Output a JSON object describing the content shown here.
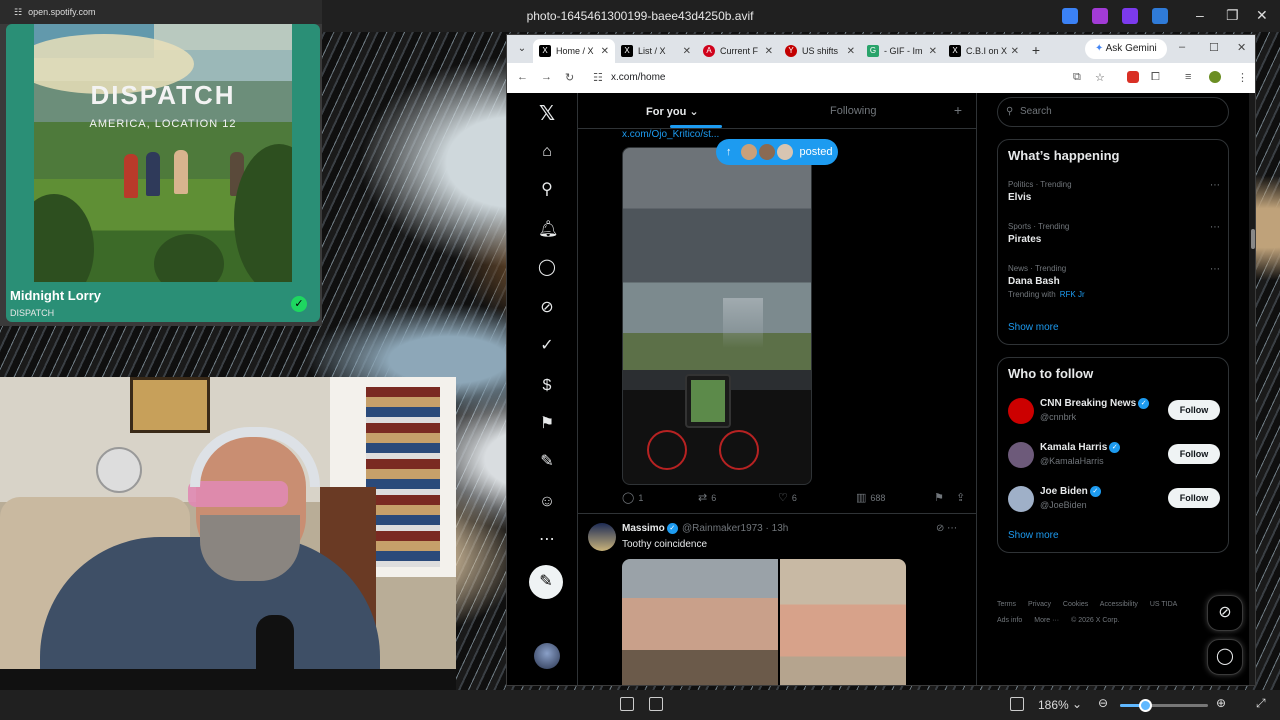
{
  "viewer": {
    "file_name": "photo-1645461300199-baee43d4250b.avif",
    "zoom": "186%",
    "zoom_fraction": 0.28
  },
  "spotify": {
    "url": "open.spotify.com",
    "album_title": "DISPATCH",
    "album_subtitle": "AMERICA, LOCATION 12",
    "track": "Midnight Lorry",
    "artist": "DISPATCH",
    "accent": "#1ed760"
  },
  "browser": {
    "tabs": [
      {
        "label": "Home / X",
        "icon": "x-logo-icon",
        "color": "#000000",
        "glyph": "X",
        "active": true
      },
      {
        "label": "List / X",
        "icon": "x-logo-icon",
        "color": "#000000",
        "glyph": "X",
        "active": false
      },
      {
        "label": "Current F",
        "icon": "red-a-icon",
        "color": "#d0021b",
        "glyph": "A",
        "active": false
      },
      {
        "label": "US shifts",
        "icon": "yahoo-icon",
        "color": "#c20000",
        "glyph": "Y",
        "active": false
      },
      {
        "label": "- GIF - Im",
        "icon": "gif-icon",
        "color": "#29a36a",
        "glyph": "G",
        "active": false
      },
      {
        "label": "C.B.I on X",
        "icon": "x-logo-icon",
        "color": "#000000",
        "glyph": "X",
        "active": false
      }
    ],
    "gemini_label": "Ask Gemini",
    "url": "x.com/home"
  },
  "x": {
    "feed_tabs": {
      "for_you": "For you",
      "following": "Following"
    },
    "post1": {
      "link": "x.com/Ojo_Kritico/st...",
      "posted_label": "posted",
      "replies": "1",
      "reposts": "6",
      "likes": "6",
      "views": "688"
    },
    "post2": {
      "name": "Massimo",
      "handle": "@Rainmaker1973 · 13h",
      "text": "Toothy coincidence"
    },
    "search_placeholder": "Search",
    "happening": {
      "title": "What’s happening",
      "trends": [
        {
          "meta": "Politics · Trending",
          "name": "Elvis",
          "with": ""
        },
        {
          "meta": "Sports · Trending",
          "name": "Pirates",
          "with": ""
        },
        {
          "meta": "News · Trending",
          "name": "Dana Bash",
          "with": "Trending with",
          "with_hl": "RFK Jr"
        }
      ],
      "show_more": "Show more"
    },
    "who_to_follow": {
      "title": "Who to follow",
      "accounts": [
        {
          "name": "CNN Breaking News",
          "handle": "@cnnbrk",
          "button": "Follow",
          "avatar_color": "#cc0000"
        },
        {
          "name": "Kamala Harris",
          "handle": "@KamalaHarris",
          "button": "Follow",
          "avatar_color": "#6d5a7a"
        },
        {
          "name": "Joe Biden",
          "handle": "@JoeBiden",
          "button": "Follow",
          "avatar_color": "#9fb0c8"
        }
      ],
      "show_more": "Show more"
    },
    "footer": [
      "Terms",
      "Privacy",
      "Cookies",
      "Accessibility",
      "US TIDA",
      "Ads info",
      "More ···",
      "© 2026 X Corp."
    ]
  }
}
